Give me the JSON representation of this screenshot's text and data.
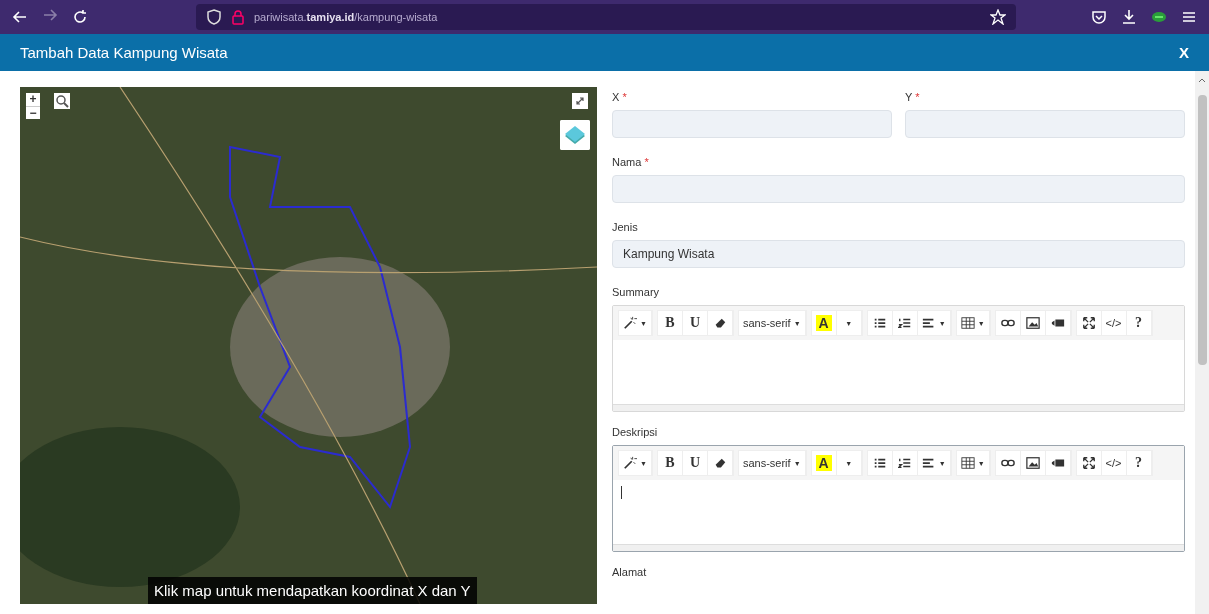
{
  "browser": {
    "url": "pariwisata.**tamiya.id**/kampung-wisata",
    "forward_disabled": true
  },
  "modal": {
    "title": "Tambah Data Kampung Wisata",
    "close": "X"
  },
  "map": {
    "zoom_in": "+",
    "zoom_out": "−",
    "caption": "Klik map untuk mendapatkan koordinat X dan Y"
  },
  "form": {
    "coords": [
      {
        "label": "X",
        "required_mark": "*"
      },
      {
        "label": "Y",
        "required_mark": "*"
      }
    ],
    "fields": [
      {
        "label": "Nama",
        "required_mark": "*"
      },
      {
        "label": "Jenis",
        "value": "Kampung Wisata"
      }
    ],
    "editors": [
      {
        "label": "Summary",
        "focused": false,
        "toolbar": [
          [
            {
              "kind": "icon",
              "caret": "▼"
            }
          ],
          [
            {
              "kind": "text",
              "label": "B"
            },
            {
              "kind": "text",
              "label": "U"
            },
            {
              "kind": "icon"
            }
          ],
          [
            {
              "kind": "text",
              "label": "sans-serif",
              "caret": "▼"
            }
          ],
          [
            {
              "kind": "highlight",
              "label": "A"
            },
            {
              "kind": "text",
              "label": "▼"
            }
          ],
          [
            {
              "kind": "icon"
            },
            {
              "kind": "icon"
            },
            {
              "kind": "icon",
              "caret": "▼"
            }
          ],
          [
            {
              "kind": "icon",
              "caret": "▼"
            }
          ],
          [
            {
              "kind": "icon"
            },
            {
              "kind": "icon"
            },
            {
              "kind": "icon"
            }
          ],
          [
            {
              "kind": "icon"
            },
            {
              "kind": "text",
              "label": "</>"
            },
            {
              "kind": "text",
              "label": "?"
            }
          ]
        ]
      },
      {
        "label": "Deskripsi",
        "focused": true,
        "toolbar": [
          [
            {
              "kind": "icon",
              "caret": "▼"
            }
          ],
          [
            {
              "kind": "text",
              "label": "B"
            },
            {
              "kind": "text",
              "label": "U"
            },
            {
              "kind": "icon"
            }
          ],
          [
            {
              "kind": "text",
              "label": "sans-serif",
              "caret": "▼"
            }
          ],
          [
            {
              "kind": "highlight",
              "label": "A"
            },
            {
              "kind": "text",
              "label": "▼"
            }
          ],
          [
            {
              "kind": "icon"
            },
            {
              "kind": "icon"
            },
            {
              "kind": "icon",
              "caret": "▼"
            }
          ],
          [
            {
              "kind": "icon",
              "caret": "▼"
            }
          ],
          [
            {
              "kind": "icon"
            },
            {
              "kind": "icon"
            },
            {
              "kind": "icon"
            }
          ],
          [
            {
              "kind": "icon"
            },
            {
              "kind": "text",
              "label": "</>"
            },
            {
              "kind": "text",
              "label": "?"
            }
          ]
        ]
      }
    ],
    "next_label": "Alamat"
  }
}
